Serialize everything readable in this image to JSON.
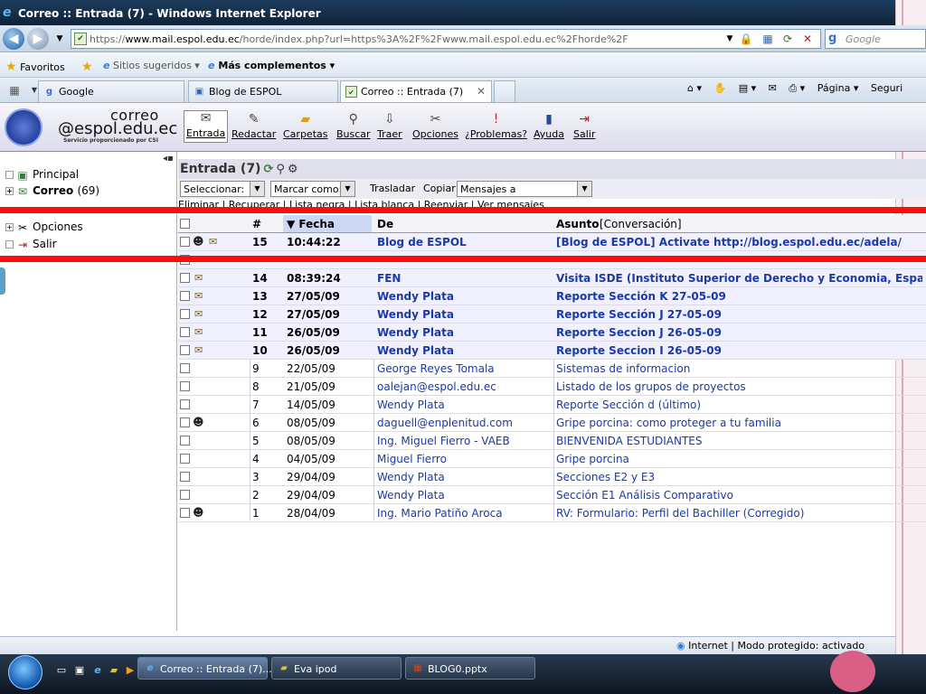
{
  "window": {
    "title": "Correo :: Entrada (7) - Windows Internet Explorer"
  },
  "addressbar": {
    "url_prefix": "https://",
    "url_host": "www.mail.espol.edu.ec",
    "url_rest": "/horde/index.php?url=https%3A%2F%2Fwww.mail.espol.edu.ec%2Fhorde%2F",
    "search_placeholder": "Google"
  },
  "favorites": {
    "label": "Favoritos",
    "suggested": "Sitios sugeridos ▾",
    "addons": "Más complementos ▾"
  },
  "tabs": [
    {
      "label": "Google"
    },
    {
      "label": "Blog de ESPOL"
    },
    {
      "label": "Correo :: Entrada (7)"
    }
  ],
  "commandbar": {
    "page": "Página ▾",
    "security": "Seguri"
  },
  "brand": {
    "line1": "correo",
    "line2": "@espol.edu.ec",
    "line3": "Servicio proporcionado por CSI"
  },
  "toolbar": [
    {
      "label": "Entrada",
      "icon": "inbox-icon"
    },
    {
      "label": "Redactar",
      "icon": "compose-icon"
    },
    {
      "label": "Carpetas",
      "icon": "folder-icon"
    },
    {
      "label": "Buscar",
      "icon": "search-icon"
    },
    {
      "label": "Traer",
      "icon": "fetch-icon"
    },
    {
      "label": "Opciones",
      "icon": "tools-icon"
    },
    {
      "label": "¿Problemas?",
      "icon": "help-icon"
    },
    {
      "label": "Ayuda",
      "icon": "book-icon"
    },
    {
      "label": "Salir",
      "icon": "exit-icon"
    }
  ],
  "sidebar": {
    "items": [
      {
        "label": "Principal"
      },
      {
        "label": "Correo",
        "count": "(69)"
      },
      {
        "label": "Opciones"
      },
      {
        "label": "Salir"
      }
    ]
  },
  "mailbox": {
    "title": "Entrada (7)",
    "select_label": "Seleccionar:",
    "mark_label": "Marcar como:",
    "move_label": "Trasladar",
    "copy_label": "Copiar",
    "target_label": "Mensajes a",
    "links_row": "Eliminar | Recuperar | Lista negra | Lista blanca | Reenviar | Ver mensajes"
  },
  "table": {
    "headers": {
      "num": "#",
      "date": "▼ Fecha",
      "from": "De",
      "subject": "Asunto",
      "conversation": "[Conversación]"
    },
    "rows": [
      {
        "num": "15",
        "date": "10:44:22",
        "from": "Blog de ESPOL",
        "subject": "[Blog de ESPOL] Activate http://blog.espol.edu.ec/adela/",
        "unread": true,
        "icons": [
          "person",
          "envelope"
        ]
      },
      {
        "num": "",
        "date": "",
        "from": "",
        "subject": "",
        "unread": true,
        "icons": []
      },
      {
        "num": "14",
        "date": "08:39:24",
        "from": "FEN",
        "subject": "Visita ISDE (Instituto Superior de Derecho y Economia, España).",
        "unread": true,
        "icons": [
          "envelope"
        ]
      },
      {
        "num": "13",
        "date": "27/05/09",
        "from": "Wendy Plata",
        "subject": "Reporte Sección K 27-05-09",
        "unread": true,
        "icons": [
          "envelope"
        ]
      },
      {
        "num": "12",
        "date": "27/05/09",
        "from": "Wendy Plata",
        "subject": "Reporte Sección J 27-05-09",
        "unread": true,
        "icons": [
          "envelope"
        ]
      },
      {
        "num": "11",
        "date": "26/05/09",
        "from": "Wendy Plata",
        "subject": "Reporte Seccion J 26-05-09",
        "unread": true,
        "icons": [
          "envelope"
        ]
      },
      {
        "num": "10",
        "date": "26/05/09",
        "from": "Wendy Plata",
        "subject": "Reporte Seccion I 26-05-09",
        "unread": true,
        "icons": [
          "envelope"
        ]
      },
      {
        "num": "9",
        "date": "22/05/09",
        "from": "George Reyes Tomala",
        "subject": "Sistemas de informacion",
        "unread": false,
        "icons": []
      },
      {
        "num": "8",
        "date": "21/05/09",
        "from": "oalejan@espol.edu.ec",
        "subject": "Listado de los grupos de proyectos",
        "unread": false,
        "icons": []
      },
      {
        "num": "7",
        "date": "14/05/09",
        "from": "Wendy Plata",
        "subject": "Reporte Sección d (último)",
        "unread": false,
        "icons": []
      },
      {
        "num": "6",
        "date": "08/05/09",
        "from": "daguell@enplenitud.com",
        "subject": "Gripe porcina: como proteger a tu familia",
        "unread": false,
        "icons": [
          "person"
        ]
      },
      {
        "num": "5",
        "date": "08/05/09",
        "from": "Ing. Miguel Fierro - VAEB",
        "subject": "BIENVENIDA ESTUDIANTES",
        "unread": false,
        "icons": []
      },
      {
        "num": "4",
        "date": "04/05/09",
        "from": "Miguel Fierro",
        "subject": "Gripe porcina",
        "unread": false,
        "icons": []
      },
      {
        "num": "3",
        "date": "29/04/09",
        "from": "Wendy Plata",
        "subject": "Secciones E2 y E3",
        "unread": false,
        "icons": []
      },
      {
        "num": "2",
        "date": "29/04/09",
        "from": "Wendy Plata",
        "subject": "Sección E1 Análisis Comparativo",
        "unread": false,
        "icons": []
      },
      {
        "num": "1",
        "date": "28/04/09",
        "from": "Ing. Mario Patiño Aroca",
        "subject": "RV: Formulario: Perfil del Bachiller (Corregido)",
        "unread": false,
        "icons": [
          "person"
        ]
      }
    ]
  },
  "status": {
    "text": "Internet | Modo protegido: activado"
  },
  "taskbar": {
    "tasks": [
      {
        "label": "Correo :: Entrada (7)..."
      },
      {
        "label": "Eva ipod"
      },
      {
        "label": "BLOG0.pptx"
      }
    ]
  },
  "colors": {
    "highlight": "#ff0d0d",
    "link": "#1a3aa8",
    "unread_bg": "#f0f0ff"
  }
}
